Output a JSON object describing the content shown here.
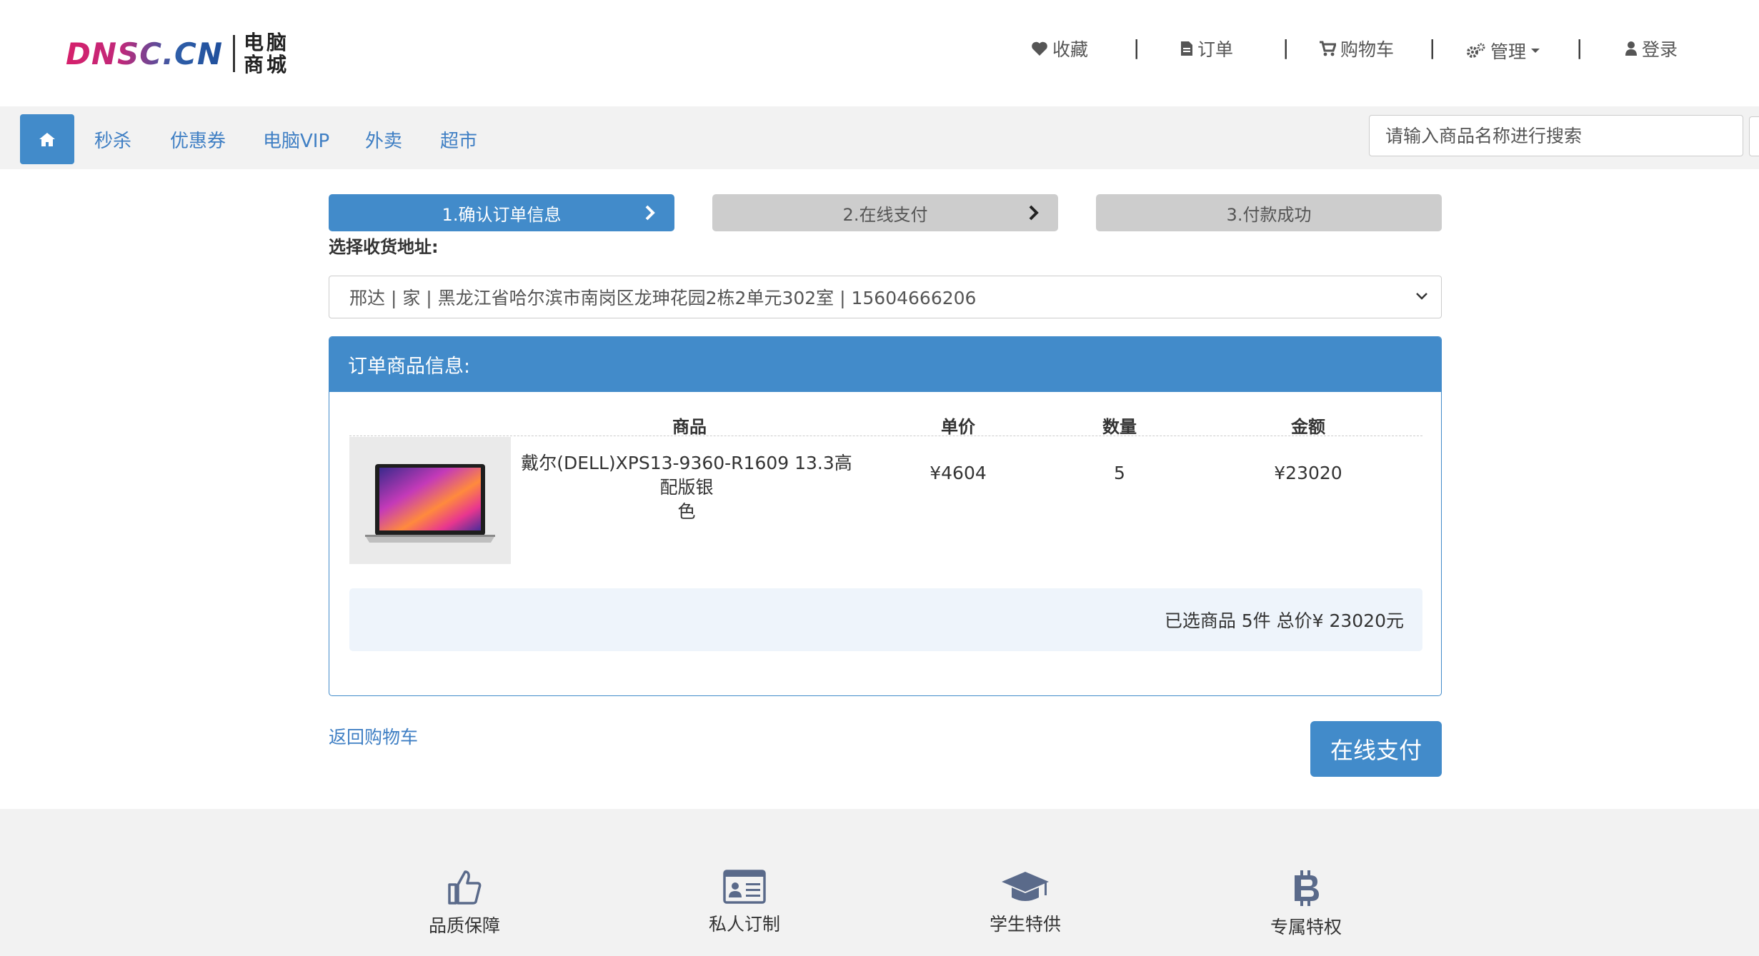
{
  "header": {
    "logo_text": "DNSC.CN",
    "logo_cn": "电脑商城",
    "nav": [
      {
        "label": "收藏",
        "icon": "heart-icon"
      },
      {
        "label": "订单",
        "icon": "file-icon"
      },
      {
        "label": "购物车",
        "icon": "cart-icon"
      },
      {
        "label": "管理",
        "icon": "gears-icon"
      },
      {
        "label": "登录",
        "icon": "user-icon"
      }
    ],
    "separator": "|"
  },
  "subnav": {
    "links": [
      "秒杀",
      "优惠券",
      "电脑VIP",
      "外卖",
      "超市"
    ],
    "search_placeholder": "请输入商品名称进行搜索"
  },
  "steps": [
    {
      "label": "1.确认订单信息",
      "state": "active"
    },
    {
      "label": "2.在线支付",
      "state": "inactive"
    },
    {
      "label": "3.付款成功",
      "state": "inactive"
    }
  ],
  "address": {
    "label": "选择收货地址:",
    "selected": "邢达 | 家 | 黑龙江省哈尔滨市南岗区龙珅花园2栋2单元302室 | 15604666206"
  },
  "order": {
    "title": "订单商品信息:",
    "columns": [
      "商品",
      "单价",
      "数量",
      "金额"
    ],
    "rows": [
      {
        "name_line1": "戴尔(DELL)XPS13-9360-R1609 13.3高配版银",
        "name_line2": "色",
        "price": "¥4604",
        "qty": "5",
        "amount": "¥23020"
      }
    ],
    "summary": "已选商品 5件 总价¥ 23020元"
  },
  "actions": {
    "back": "返回购物车",
    "pay": "在线支付"
  },
  "footer": {
    "features": [
      {
        "label": "品质保障",
        "icon": "thumbs-up-icon"
      },
      {
        "label": "私人订制",
        "icon": "id-card-icon"
      },
      {
        "label": "学生特供",
        "icon": "graduation-cap-icon"
      },
      {
        "label": "专属特权",
        "icon": "bitcoin-icon"
      }
    ]
  },
  "colors": {
    "accent": "#428bca",
    "link": "#3f7fc4",
    "icon": "#5a6a8a"
  }
}
